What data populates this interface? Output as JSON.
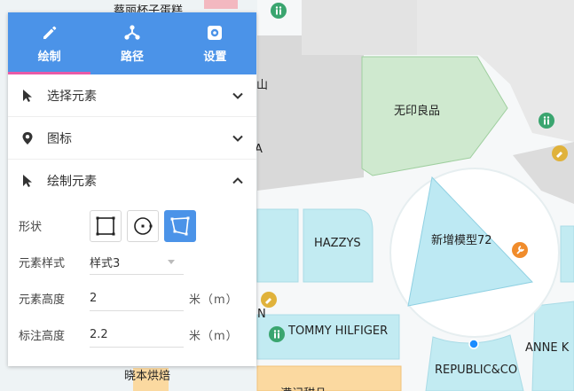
{
  "map": {
    "labels": {
      "top_shop": "蔡丽杯子蛋糕",
      "muji": "无印良品",
      "shan": "山",
      "a_partial": "A",
      "hazzys": "HAZZYS",
      "new_model": "新增模型72",
      "n_partial": "N",
      "tommy": "TOMMY HILFIGER",
      "anne": "ANNE K",
      "republic": "REPUBLIC&CO",
      "bakery": "晓本烘焙",
      "bottom_shop": "满记甜品"
    }
  },
  "panel": {
    "tabs": [
      {
        "label": "绘制",
        "icon": "pencil-icon"
      },
      {
        "label": "路径",
        "icon": "route-icon"
      },
      {
        "label": "设置",
        "icon": "gear-icon"
      }
    ],
    "sections": {
      "select": {
        "label": "选择元素"
      },
      "marker": {
        "label": "图标"
      },
      "draw": {
        "label": "绘制元素"
      }
    },
    "form": {
      "shape_label": "形状",
      "style_label": "元素样式",
      "style_value": "样式3",
      "height_label": "元素高度",
      "height_value": "2",
      "height_unit": "米（m）",
      "label_height_label": "标注高度",
      "label_height_value": "2.2",
      "label_height_unit": "米（m）"
    }
  }
}
